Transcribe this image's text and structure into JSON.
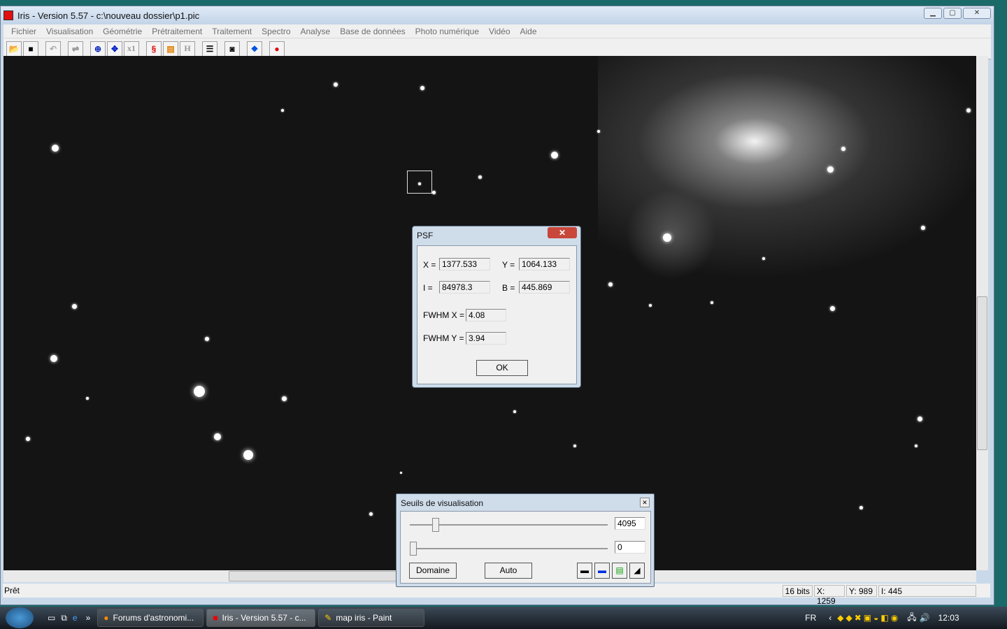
{
  "window": {
    "title": "Iris - Version 5.57 - c:\\nouveau dossier\\p1.pic"
  },
  "menu": [
    "Fichier",
    "Visualisation",
    "Géométrie",
    "Prétraitement",
    "Traitement",
    "Spectro",
    "Analyse",
    "Base de données",
    "Photo numérique",
    "Vidéo",
    "Aide"
  ],
  "toolbar": {
    "icons": [
      "open-folder-icon",
      "save-icon",
      "undo-icon",
      "threshold-icon",
      "zoom-in-icon",
      "zoom-out-icon",
      "x1",
      "red-spiral-icon",
      "palette-icon",
      "H",
      "list-icon",
      "camera-icon",
      "blue-diamond-icon",
      "red-record-icon"
    ],
    "x1_label": "x1",
    "h_label": "H"
  },
  "psf": {
    "title": "PSF",
    "x_label": "X =",
    "x": "1377.533",
    "y_label": "Y =",
    "y": "1064.133",
    "i_label": "I =",
    "i": "84978.3",
    "b_label": "B =",
    "b": "445.869",
    "fwhmx_label": "FWHM X =",
    "fwhmx": "4.08",
    "fwhmy_label": "FWHM Y =",
    "fwhmy": "3.94",
    "ok": "OK"
  },
  "seuils": {
    "title": "Seuils de visualisation",
    "high": "4095",
    "low": "0",
    "high_slider_fraction": 0.13,
    "low_slider_fraction": 0.0,
    "domaine": "Domaine",
    "auto": "Auto"
  },
  "status": {
    "ready": "Prêt",
    "bits": "16 bits",
    "x": "X: 1259",
    "y": "Y: 989",
    "i": "I: 445"
  },
  "taskbar": {
    "tasks": [
      "Forums d'astronomi...",
      "Iris - Version 5.57 - c...",
      "map iris - Paint"
    ],
    "lang": "FR",
    "clock": "12:03"
  }
}
